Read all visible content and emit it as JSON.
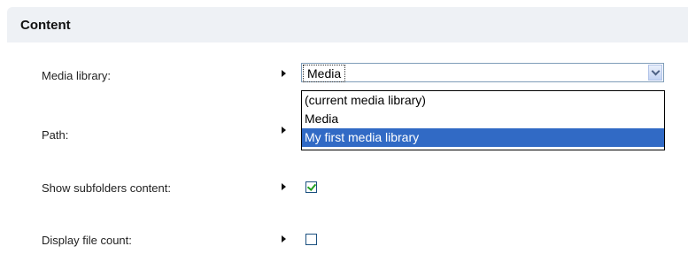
{
  "panel": {
    "title": "Content"
  },
  "fields": {
    "media_library": {
      "label": "Media library:",
      "value": "Media",
      "options": [
        "(current media library)",
        "Media",
        "My first media library"
      ],
      "highlighted_option": "My first media library"
    },
    "path": {
      "label": "Path:"
    },
    "show_subfolders": {
      "label": "Show subfolders content:",
      "checked": true
    },
    "display_file_count": {
      "label": "Display file count:",
      "checked": false
    }
  },
  "colors": {
    "header_bg": "#eef1f5",
    "highlight": "#316ac5",
    "check": "#21a121"
  },
  "icons": [
    "arrow-right-icon",
    "chevron-down-icon",
    "checkmark-icon"
  ]
}
